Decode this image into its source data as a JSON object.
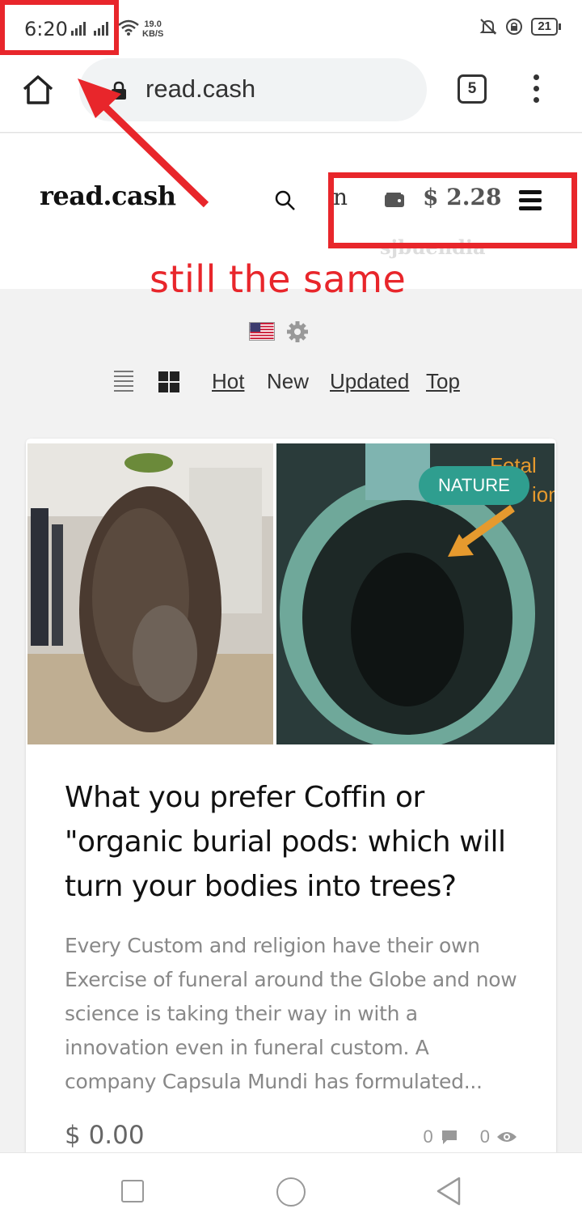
{
  "status_bar": {
    "time": "6:20",
    "net_speed_value": "19.0",
    "net_speed_unit": "KB/S",
    "battery": "21"
  },
  "browser": {
    "url": "read.cash",
    "tab_count": "5"
  },
  "site": {
    "logo": "read.cash",
    "balance": "$ 2.28",
    "username": "sjbuendia"
  },
  "annotation": {
    "text": "still the same",
    "color": "#e8262b"
  },
  "sort_tabs": [
    {
      "label": "Hot",
      "underlined": true
    },
    {
      "label": "New",
      "underlined": false
    },
    {
      "label": "Updated",
      "underlined": true
    },
    {
      "label": "Top",
      "underlined": true
    }
  ],
  "article": {
    "tag": "NATURE",
    "image_overlay_text": "Fetal",
    "image_overlay_text_2": "ion",
    "title": "What you prefer Coffin or \"organic burial pods: which will turn your bodies into trees?",
    "excerpt": "Every Custom and religion have their own Exercise of funeral around the Globe and now science is taking their way in with a innovation even in funeral custom. A company Capsula Mundi has formulated...",
    "earned": "$ 0.00",
    "comments": "0",
    "views": "0"
  },
  "colors": {
    "tag_bg": "#2f9e8f",
    "annotation_red": "#e8262b"
  }
}
